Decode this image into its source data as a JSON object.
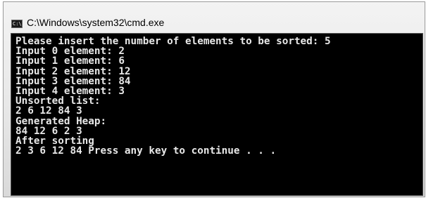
{
  "window": {
    "title": "C:\\Windows\\system32\\cmd.exe",
    "icon": "cmd-icon",
    "icon_text": "C:\\"
  },
  "console": {
    "lines": [
      "Please insert the number of elements to be sorted: 5",
      "Input 0 element: 2",
      "Input 1 element: 6",
      "Input 2 element: 12",
      "Input 3 element: 84",
      "Input 4 element: 3",
      "Unsorted list:",
      "2 6 12 84 3",
      "Generated Heap:",
      "84 12 6 2 3",
      "After sorting",
      "2 3 6 12 84 Press any key to continue . . ."
    ]
  },
  "colors": {
    "console_background": "#000000",
    "console_text": "#e8e8e8",
    "title_text": "#000000"
  }
}
